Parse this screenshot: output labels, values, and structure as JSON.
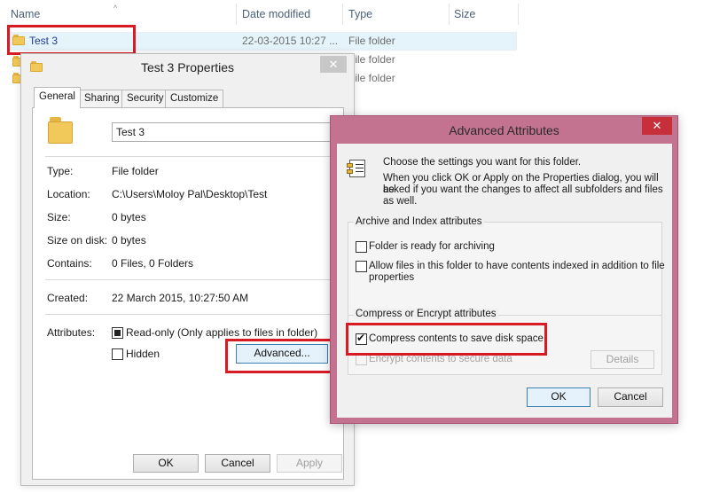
{
  "explorer": {
    "columns": [
      "Name",
      "Date modified",
      "Type",
      "Size"
    ],
    "rows": [
      {
        "name": "Test 3",
        "date": "22-03-2015 10:27 ...",
        "type": "File folder"
      },
      {
        "type": "File folder"
      },
      {
        "type": "File folder"
      }
    ]
  },
  "properties": {
    "title": "Test 3 Properties",
    "close_glyph": "✕",
    "tabs": [
      "General",
      "Sharing",
      "Security",
      "Customize"
    ],
    "folder_name": "Test 3",
    "fields": [
      {
        "label": "Type:",
        "value": "File folder"
      },
      {
        "label": "Location:",
        "value": "C:\\Users\\Moloy Pal\\Desktop\\Test"
      },
      {
        "label": "Size:",
        "value": "0 bytes"
      },
      {
        "label": "Size on disk:",
        "value": "0 bytes"
      },
      {
        "label": "Contains:",
        "value": "0 Files, 0 Folders"
      }
    ],
    "created_label": "Created:",
    "created_value": "22 March 2015, 10:27:50 AM",
    "attributes_label": "Attributes:",
    "readonly_label": "Read-only (Only applies to files in folder)",
    "hidden_label": "Hidden",
    "advanced_button": "Advanced...",
    "ok": "OK",
    "cancel": "Cancel",
    "apply": "Apply"
  },
  "advanced": {
    "title": "Advanced Attributes",
    "close_glyph": "✕",
    "intro": "Choose the settings you want for this folder.",
    "intro_detail_1": "When you click OK or Apply on the Properties dialog, you will be",
    "intro_detail_2": "asked if you want the changes to affect all subfolders and files",
    "intro_detail_3": "as well.",
    "archive_group": "Archive and Index attributes",
    "archive_label": "Folder is ready for archiving",
    "index_label_1": "Allow files in this folder to have contents indexed in addition to file",
    "index_label_2": "properties",
    "compress_group": "Compress or Encrypt attributes",
    "compress_label": "Compress contents to save disk space",
    "encrypt_label": "Encrypt contents to secure data",
    "details": "Details",
    "ok": "OK",
    "cancel": "Cancel"
  },
  "colors": {
    "highlight_red": "#d71b25",
    "advanced_frame": "#c3738f",
    "selection": "#e5f3fb"
  }
}
